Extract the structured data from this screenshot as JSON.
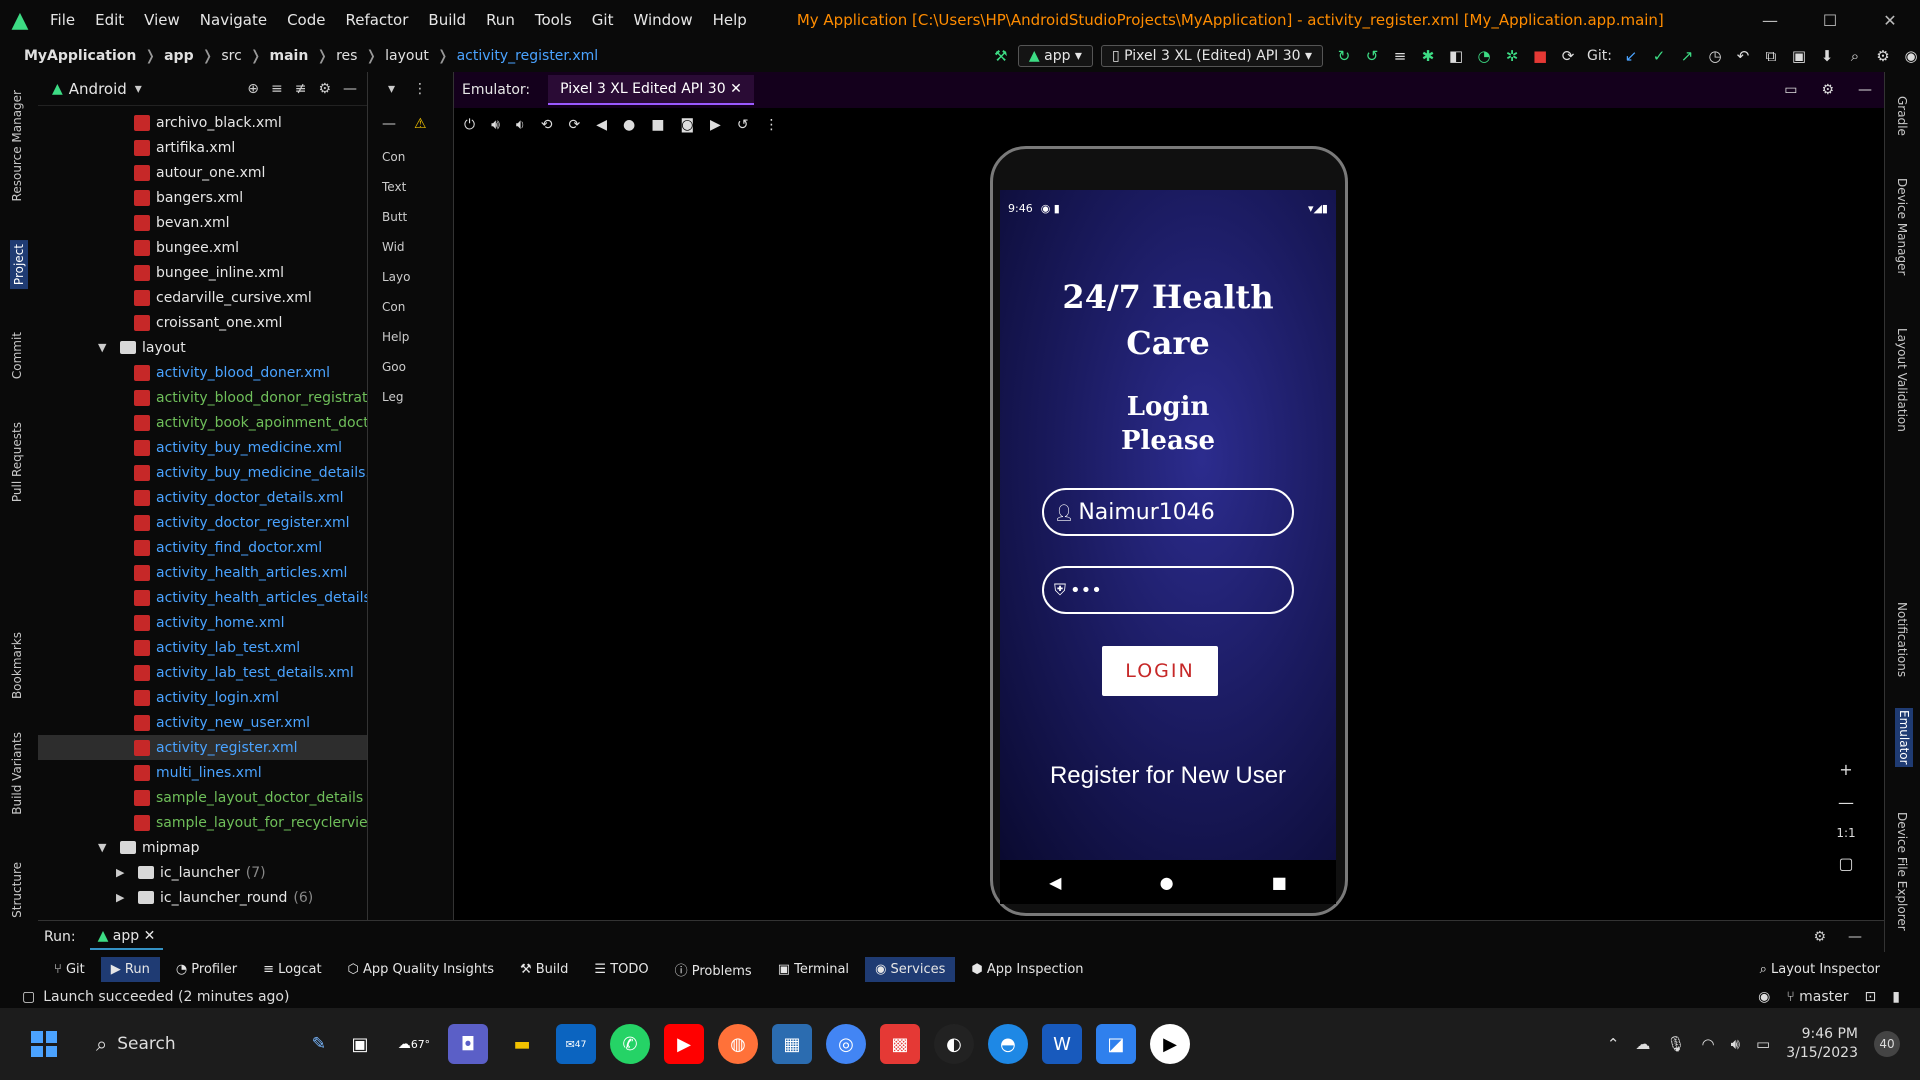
{
  "window": {
    "title": "My Application [C:\\Users\\HP\\AndroidStudioProjects\\MyApplication] - activity_register.xml [My_Application.app.main]",
    "menu": [
      "File",
      "Edit",
      "View",
      "Navigate",
      "Code",
      "Refactor",
      "Build",
      "Run",
      "Tools",
      "Git",
      "Window",
      "Help"
    ]
  },
  "breadcrumb": [
    "MyApplication",
    "app",
    "src",
    "main",
    "res",
    "layout",
    "activity_register.xml"
  ],
  "toolbar": {
    "run_config": "app",
    "device": "Pixel 3 XL (Edited) API 30",
    "git_label": "Git:"
  },
  "left_tabs": [
    "Resource Manager",
    "Project",
    "Commit",
    "Pull Requests",
    "Bookmarks",
    "Build Variants",
    "Structure"
  ],
  "project": {
    "view_mode": "Android",
    "font_files": [
      "archivo_black.xml",
      "artifika.xml",
      "autour_one.xml",
      "bangers.xml",
      "bevan.xml",
      "bungee.xml",
      "bungee_inline.xml",
      "cedarville_cursive.xml",
      "croissant_one.xml"
    ],
    "layout_folder": "layout",
    "layout_files": [
      "activity_blood_doner.xml",
      "activity_blood_donor_registratio",
      "activity_book_apoinment_docto",
      "activity_buy_medicine.xml",
      "activity_buy_medicine_details.xr",
      "activity_doctor_details.xml",
      "activity_doctor_register.xml",
      "activity_find_doctor.xml",
      "activity_health_articles.xml",
      "activity_health_articles_details.x",
      "activity_home.xml",
      "activity_lab_test.xml",
      "activity_lab_test_details.xml",
      "activity_login.xml",
      "activity_new_user.xml",
      "activity_register.xml",
      "multi_lines.xml",
      "sample_layout_doctor_details",
      "sample_layout_for_recyclerview"
    ],
    "selected_file": "activity_register.xml",
    "mipmap_folder": "mipmap",
    "mipmap_items": [
      {
        "name": "ic_launcher",
        "count": "(7)"
      },
      {
        "name": "ic_launcher_round",
        "count": "(6)"
      }
    ]
  },
  "palette": [
    "Con",
    "Text",
    "Butt",
    "Wid",
    "Layo",
    "Con",
    "Help",
    "Goo",
    "Leg"
  ],
  "emulator": {
    "label": "Emulator:",
    "tab": "Pixel 3 XL Edited API 30"
  },
  "phone": {
    "time": "9:46",
    "title": "24/7 Health Care",
    "subtitle": "Login Please",
    "username": "Naimur1046",
    "password_dots": "•••",
    "login_button": "LOGIN",
    "register_link": "Register for New User"
  },
  "right_tabs": [
    "Gradle",
    "Device Manager",
    "Layout Validation",
    "Notifications",
    "Emulator",
    "Device File Explorer"
  ],
  "runbar": {
    "label": "Run:",
    "tab": "app"
  },
  "tool_tabs": [
    "Git",
    "Run",
    "Profiler",
    "Logcat",
    "App Quality Insights",
    "Build",
    "TODO",
    "Problems",
    "Terminal",
    "Services",
    "App Inspection"
  ],
  "layout_inspector": "Layout Inspector",
  "status": {
    "message": "Launch succeeded (2 minutes ago)",
    "branch": "master"
  },
  "taskbar": {
    "search": "Search",
    "weather": "67°",
    "mail_badge": "47",
    "time": "9:46 PM",
    "date": "3/15/2023",
    "notifications": "40"
  }
}
